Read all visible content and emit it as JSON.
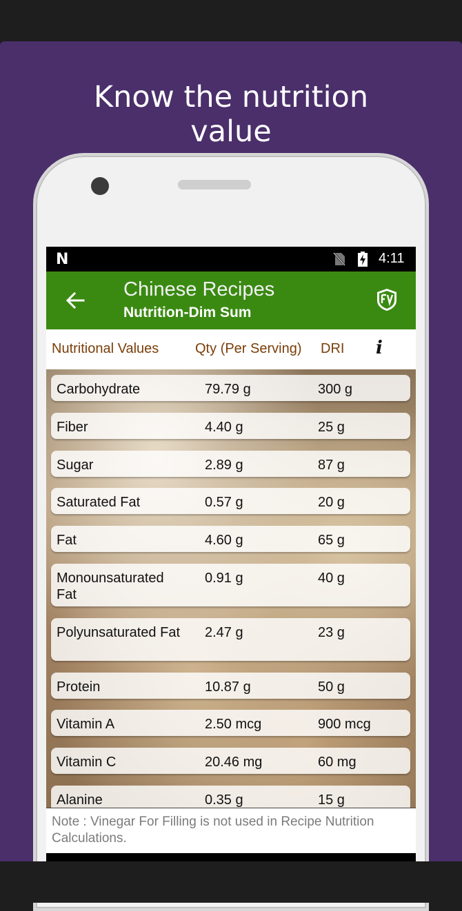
{
  "promo": {
    "headline_line1": "Know the nutrition",
    "headline_line2": "value",
    "background": "#4a2f6b"
  },
  "statusbar": {
    "left_icon": "n-icon",
    "icons": [
      "no-sim-icon",
      "battery-charging-icon"
    ],
    "time": "4:11"
  },
  "toolbar": {
    "title": "Chinese Recipes",
    "subtitle": "Nutrition-Dim Sum",
    "back_icon": "arrow-left-icon",
    "logo_icon": "app-logo-icon",
    "color": "#3a8a12"
  },
  "table": {
    "headers": [
      "Nutritional Values",
      "Qty (Per Serving)",
      "DRI"
    ],
    "info_icon": "i",
    "rows": [
      {
        "name": "Carbohydrate",
        "qty": "79.79 g",
        "dri": "300 g"
      },
      {
        "name": "Fiber",
        "qty": "4.40 g",
        "dri": "25 g"
      },
      {
        "name": "Sugar",
        "qty": "2.89 g",
        "dri": "87 g"
      },
      {
        "name": "Saturated Fat",
        "qty": "0.57 g",
        "dri": "20 g"
      },
      {
        "name": "Fat",
        "qty": "4.60 g",
        "dri": "65 g"
      },
      {
        "name": "Monounsaturated Fat",
        "qty": "0.91 g",
        "dri": "40 g"
      },
      {
        "name": "Polyunsaturated Fat",
        "qty": "2.47 g",
        "dri": "23 g"
      },
      {
        "name": "Protein",
        "qty": "10.87 g",
        "dri": "50 g"
      },
      {
        "name": "Vitamin A",
        "qty": "2.50 mcg",
        "dri": "900 mcg"
      },
      {
        "name": "Vitamin C",
        "qty": "20.46 mg",
        "dri": "60 mg"
      },
      {
        "name": "Alanine",
        "qty": "0.35 g",
        "dri": "15 g"
      }
    ]
  },
  "note": "Note : Vinegar For Filling  is not used in Recipe Nutrition Calculations."
}
